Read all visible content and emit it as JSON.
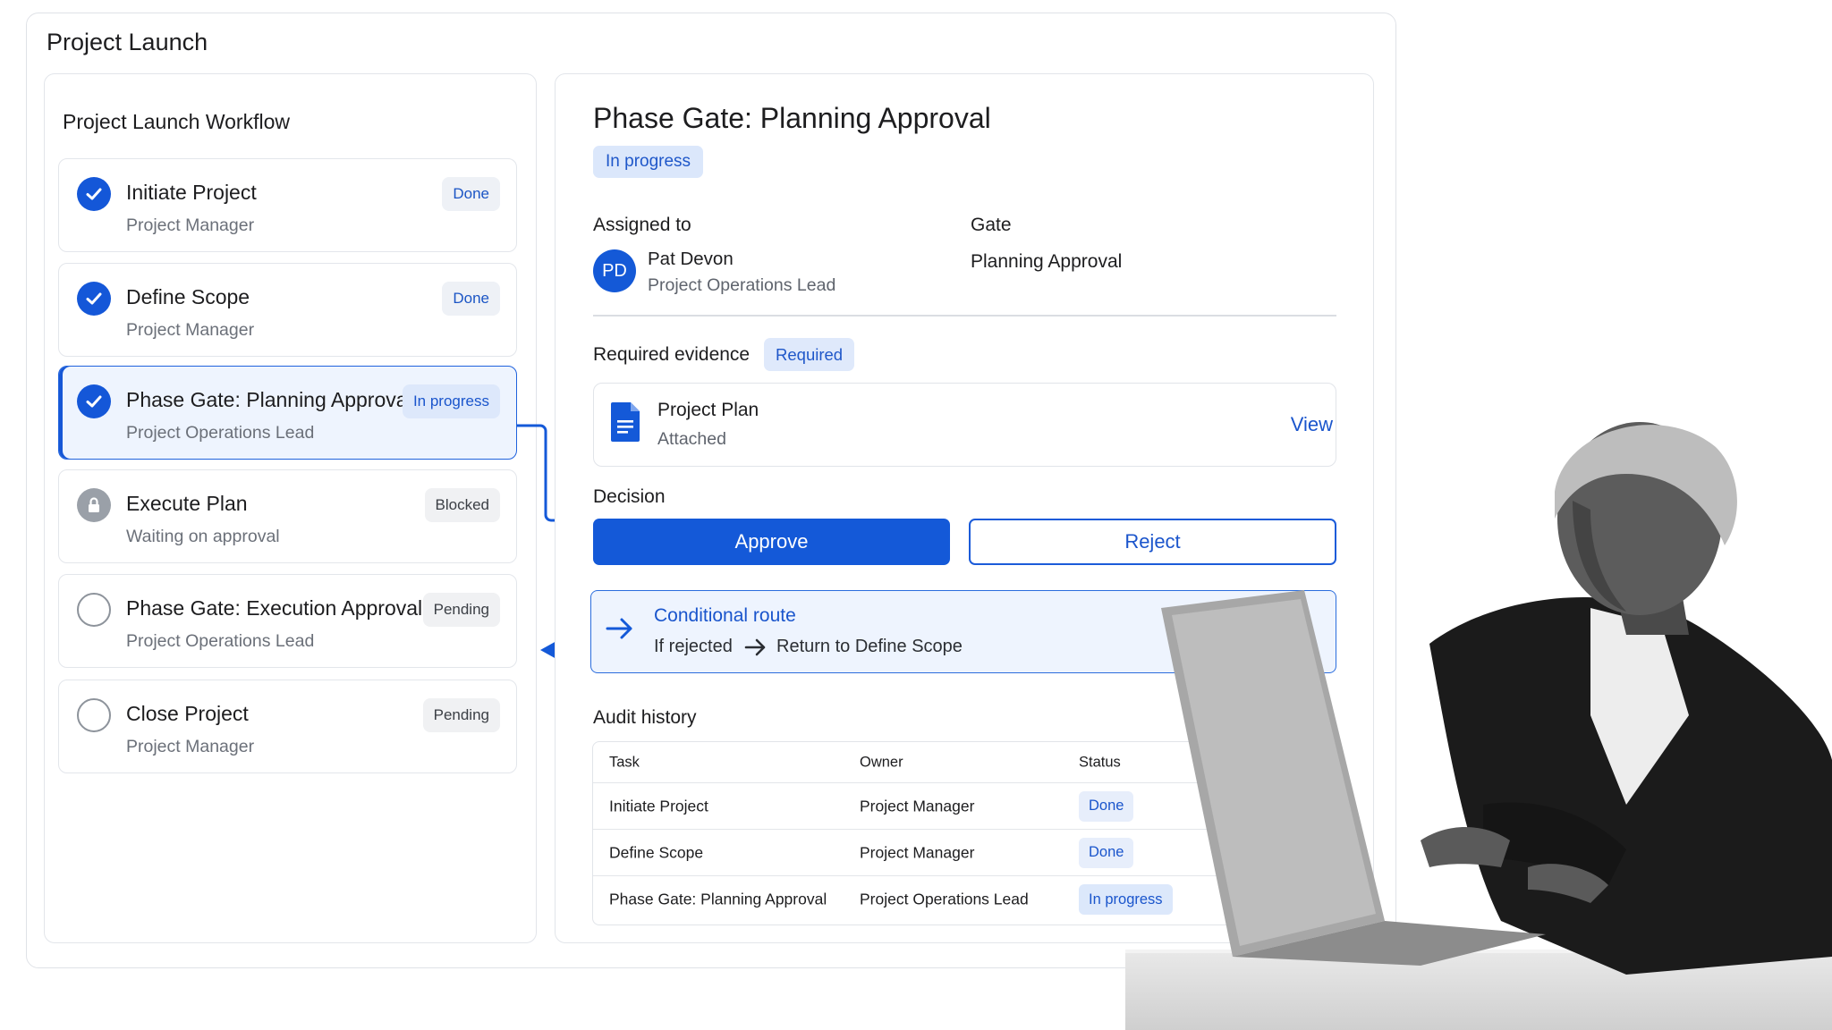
{
  "app": {
    "title": "Project Launch"
  },
  "workflow": {
    "title": "Project Launch Workflow",
    "steps": [
      {
        "name": "Initiate Project",
        "role": "Project Manager",
        "status": "Done",
        "icon": "check-circle-icon"
      },
      {
        "name": "Define Scope",
        "role": "Project Manager",
        "status": "Done",
        "icon": "check-circle-icon"
      },
      {
        "name": "Phase Gate: Planning Approval",
        "role": "Project Operations Lead",
        "status": "In progress",
        "icon": "check-circle-icon"
      },
      {
        "name": "Execute Plan",
        "role": "Waiting on approval",
        "status": "Blocked",
        "icon": "lock-icon"
      },
      {
        "name": "Phase Gate: Execution Approval",
        "role": "Project Operations Lead",
        "status": "Pending",
        "icon": "empty-circle-icon"
      },
      {
        "name": "Close Project",
        "role": "Project Manager",
        "status": "Pending",
        "icon": "empty-circle-icon"
      }
    ]
  },
  "detail": {
    "title": "Phase Gate: Planning Approval",
    "status": "In progress",
    "assigned_label": "Assigned to",
    "assignee": {
      "initials": "PD",
      "name": "Pat Devon",
      "role": "Project Operations Lead"
    },
    "gate_label": "Gate",
    "gate_value": "Planning Approval",
    "evidence_label": "Required evidence",
    "evidence_badge": "Required",
    "evidence": {
      "name": "Project Plan",
      "status": "Attached",
      "action": "View",
      "icon": "document-icon"
    },
    "decision_label": "Decision",
    "approve_label": "Approve",
    "reject_label": "Reject",
    "route": {
      "title": "Conditional route",
      "condition": "If rejected",
      "target": "Return to Define Scope"
    },
    "audit": {
      "label": "Audit history",
      "columns": [
        "Task",
        "Owner",
        "Status"
      ],
      "rows": [
        [
          "Initiate Project",
          "Project Manager",
          "Done"
        ],
        [
          "Define Scope",
          "Project Manager",
          "Done"
        ],
        [
          "Phase Gate: Planning Approval",
          "Project Operations Lead",
          "In progress"
        ]
      ]
    }
  },
  "colors": {
    "accent": "#1459d8",
    "accent_light": "#dce8fb",
    "border": "#e2e5ea"
  }
}
